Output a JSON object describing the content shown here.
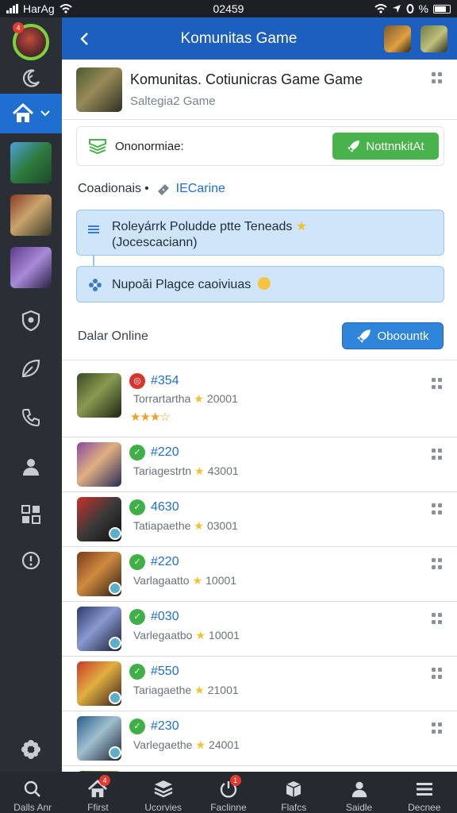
{
  "status_bar": {
    "carrier": "HarAg",
    "time": "02459",
    "battery": "%"
  },
  "header": {
    "title": "Komunitas Game"
  },
  "sidebar": {
    "avatar_badge": "4",
    "icons": [
      "moon-icon",
      "home-icon",
      "shield-icon",
      "leaf-icon",
      "phone-icon",
      "user-icon",
      "grid-icon",
      "alert-icon",
      "gear-icon"
    ]
  },
  "game": {
    "name": "Komunitas. Cotiunicras Game Game",
    "subtitle": "Saltegia2 Game"
  },
  "notification": {
    "label": "Ononormiae:",
    "button": "NottnnkitAt"
  },
  "section": {
    "label": "Coadionais",
    "link": "IECarine"
  },
  "info_boxes": [
    {
      "text": "Roleyárrk Poludde ptte Teneads",
      "sub": "(Jocescaciann)"
    },
    {
      "text": "Nupoăi Plagce caoiviuas"
    }
  ],
  "online": {
    "label": "Dalar Online",
    "button": "Oboountk"
  },
  "members": [
    {
      "id": "#354",
      "name": "Torrartartha",
      "score": "20001",
      "stars": "★★★☆",
      "badge": "red"
    },
    {
      "id": "#220",
      "name": "Tariagestrtn",
      "score": "43001",
      "badge": "green"
    },
    {
      "id": "4630",
      "name": "Tatiapaethe",
      "score": "03001",
      "badge": "green"
    },
    {
      "id": "#220",
      "name": "Varlagaatto",
      "score": "10001",
      "badge": "green"
    },
    {
      "id": "#030",
      "name": "Varlegaatbo",
      "score": "10001",
      "badge": "green"
    },
    {
      "id": "#550",
      "name": "Tariagaethe",
      "score": "21001",
      "badge": "green"
    },
    {
      "id": "#230",
      "name": "Varlegaethe",
      "score": "24001",
      "badge": "green"
    }
  ],
  "bottom_nav": [
    {
      "label": "Dalls Anr",
      "icon": "search-icon"
    },
    {
      "label": "Ffirst",
      "icon": "home-icon",
      "badge": "4"
    },
    {
      "label": "Ucorvies",
      "icon": "stack-icon"
    },
    {
      "label": "Faclinne",
      "icon": "power-icon",
      "badge": "1"
    },
    {
      "label": "Flafcs",
      "icon": "box-icon"
    },
    {
      "label": "Saidle",
      "icon": "user-icon"
    },
    {
      "label": "Decnee",
      "icon": "menu-icon"
    }
  ],
  "colors": {
    "accent": "#1d5fbf",
    "success": "#47b34a",
    "sidebar": "#2a2e35",
    "info": "#cfe5fa"
  }
}
